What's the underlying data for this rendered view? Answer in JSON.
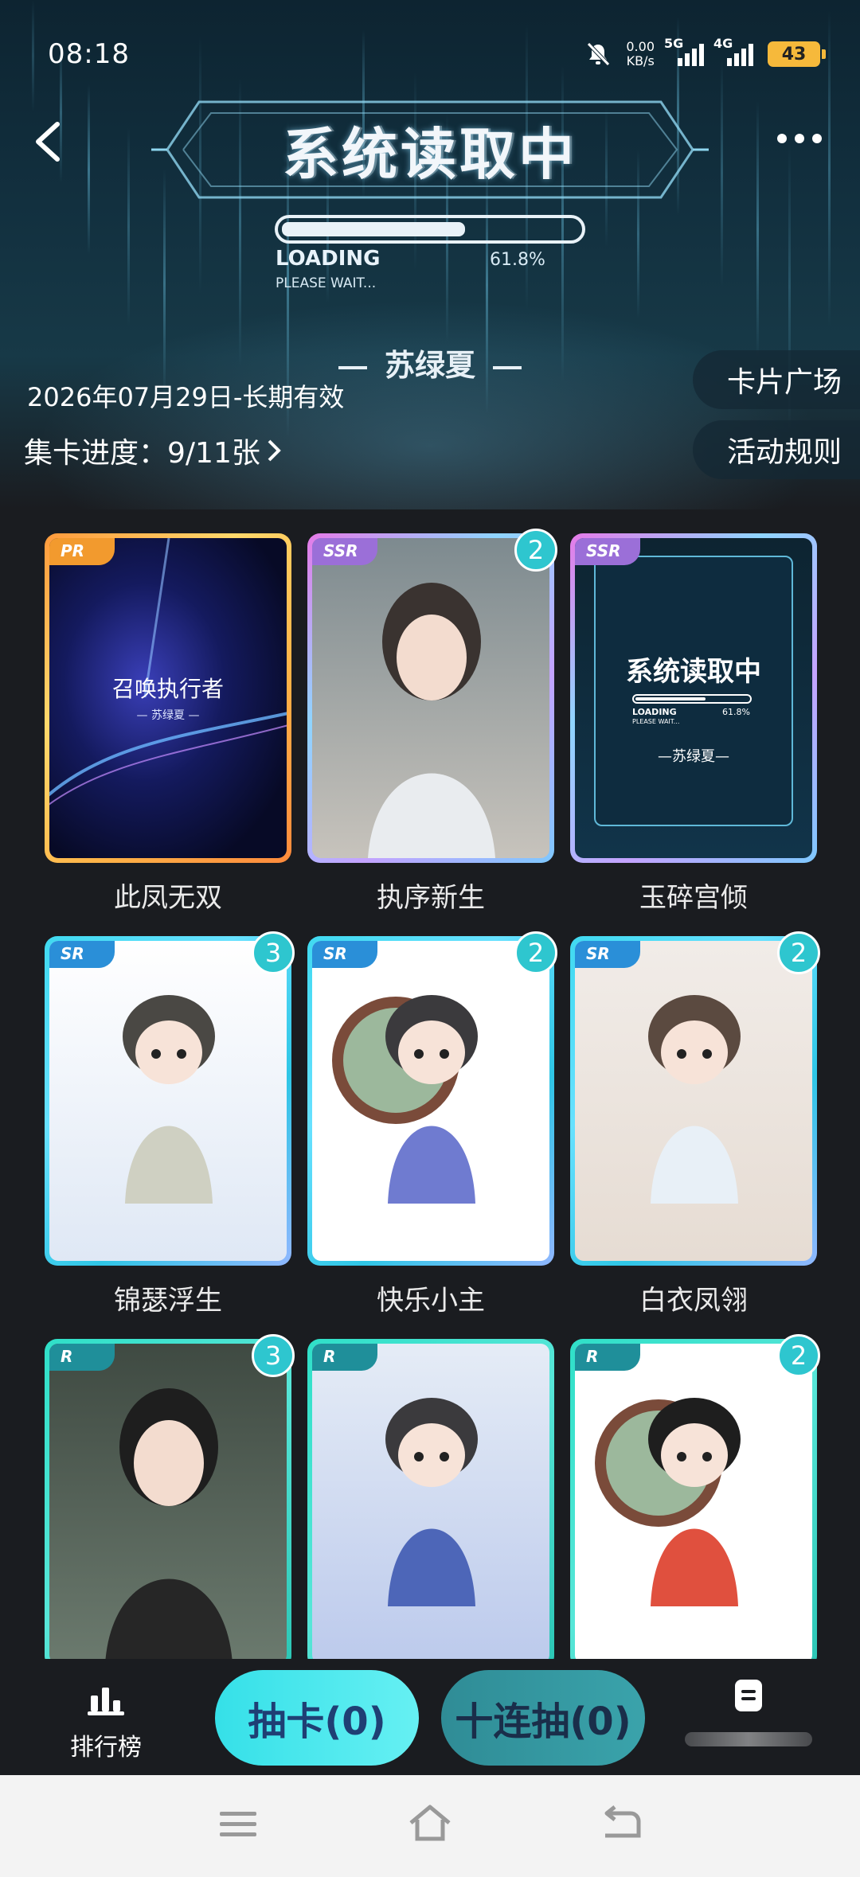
{
  "status_bar": {
    "time": "08:18",
    "net_speed_value": "0.00",
    "net_speed_unit": "KB/s",
    "sim1_label": "5G",
    "sim2_label": "4G",
    "battery": "43"
  },
  "header": {
    "big_title": "系统读取中",
    "loading_label": "LOADING",
    "loading_percent": "61.8%",
    "loading_fraction": 0.618,
    "please_wait": "PLEASE WAIT...",
    "author": "苏绿夏",
    "date_validity": "2026年07月29日-长期有效",
    "collection_progress": "集卡进度：9/11张",
    "card_square_button": "卡片广场",
    "rules_button": "活动规则"
  },
  "cards": [
    {
      "rarity": "PR",
      "name": "此凤无双",
      "count": "",
      "art_title": "召唤执行者",
      "art_sub": "— 苏绿夏 —"
    },
    {
      "rarity": "SSR",
      "name": "执序新生",
      "count": "2"
    },
    {
      "rarity": "SSR",
      "name": "玉碎宫倾",
      "count": "",
      "art_title": "系统读取中",
      "art_loading": "LOADING",
      "art_percent": "61.8%",
      "art_please": "PLEASE WAIT...",
      "art_author": "—苏绿夏—"
    },
    {
      "rarity": "SR",
      "name": "锦瑟浮生",
      "count": "3"
    },
    {
      "rarity": "SR",
      "name": "快乐小主",
      "count": "2"
    },
    {
      "rarity": "SR",
      "name": "白衣凤翎",
      "count": "2"
    },
    {
      "rarity": "R",
      "name": "",
      "count": "3"
    },
    {
      "rarity": "R",
      "name": "",
      "count": ""
    },
    {
      "rarity": "R",
      "name": "",
      "count": "2"
    }
  ],
  "bottom": {
    "rank_label": "排行榜",
    "draw_button": "抽卡(0)",
    "ten_draw_button": "十连抽(0)"
  },
  "icons": [
    "back-arrow-icon",
    "more-icon",
    "mute-icon",
    "signal-icon",
    "battery-icon",
    "chevron-right-icon",
    "rank-chart-icon",
    "notes-icon",
    "menu-icon",
    "home-icon",
    "back-nav-icon"
  ]
}
